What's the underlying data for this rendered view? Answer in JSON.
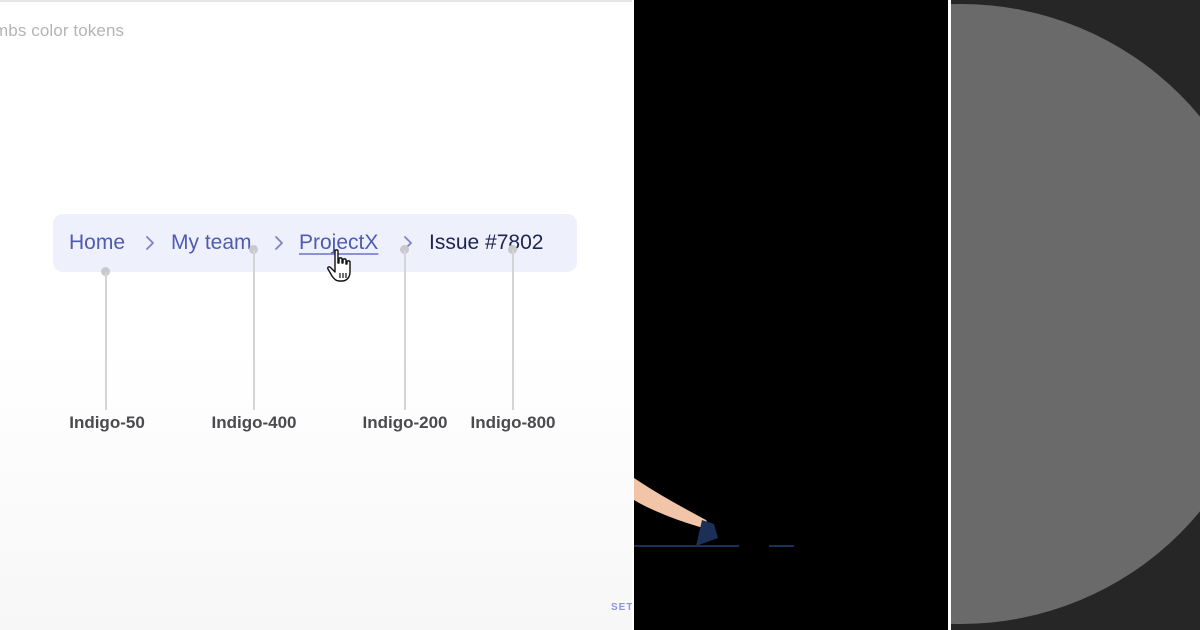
{
  "caption": "mbs color tokens",
  "breadcrumb": {
    "items": [
      {
        "label": "Home"
      },
      {
        "label": "My team"
      },
      {
        "label": "ProjectX"
      },
      {
        "label": "Issue #7802"
      }
    ],
    "separator_icon": "chevron-right-icon"
  },
  "tokens": [
    {
      "label": "Indigo-50"
    },
    {
      "label": "Indigo-400"
    },
    {
      "label": "Indigo-200"
    },
    {
      "label": "Indigo-800"
    }
  ],
  "corner_mark": "SET",
  "colors": {
    "breadcrumb_bg": "#eef0fb",
    "link": "#4f5bb0",
    "current": "#1e2454",
    "callout": "#d3d3d8",
    "right_bg": "#262626",
    "circle": "#6a6a6a"
  }
}
